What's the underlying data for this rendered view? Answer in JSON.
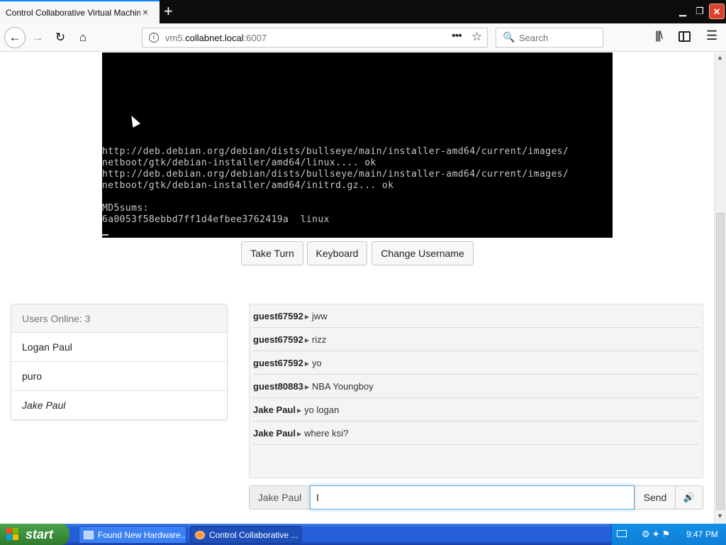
{
  "browser": {
    "tab_title": "Control Collaborative Virtual Machines!",
    "tab_close": "×",
    "new_tab": "+",
    "url_host": "vm5.",
    "url_domain": "collabnet.local",
    "url_port": ":6007",
    "search_placeholder": "Search",
    "window_min": "▁",
    "window_max": "❐",
    "window_close": "✕"
  },
  "vm": {
    "terminal_lines": [
      "http://deb.debian.org/debian/dists/bullseye/main/installer-amd64/current/images/",
      "netboot/gtk/debian-installer/amd64/linux.... ok",
      "http://deb.debian.org/debian/dists/bullseye/main/installer-amd64/current/images/",
      "netboot/gtk/debian-installer/amd64/initrd.gz... ok",
      "",
      "MD5sums:",
      "6a0053f58ebbd7ff1d4efbee3762419a  linux"
    ]
  },
  "controls": {
    "take_turn": "Take Turn",
    "keyboard": "Keyboard",
    "change_username": "Change Username"
  },
  "users": {
    "header": "Users Online: 3",
    "list": [
      "Logan Paul",
      "puro",
      "Jake Paul"
    ]
  },
  "chat": {
    "messages": [
      {
        "user": "guest67592",
        "text": "jww"
      },
      {
        "user": "guest67592",
        "text": "rizz"
      },
      {
        "user": "guest67592",
        "text": "yo"
      },
      {
        "user": "guest80883",
        "text": "NBA Youngboy"
      },
      {
        "user": "Jake Paul",
        "text": "yo logan"
      },
      {
        "user": "Jake Paul",
        "text": "where ksi?"
      }
    ],
    "username": "Jake Paul",
    "input_value": "I",
    "send_label": "Send",
    "sound_icon": "🔊"
  },
  "taskbar": {
    "start_label": "start",
    "tasks": [
      "Found New Hardware...",
      "Control Collaborative ..."
    ],
    "clock": "9:47 PM"
  },
  "colors": {
    "tab_accent": "#0a84ff",
    "taskbar_blue": "#245edb",
    "start_green": "#3c8f3c",
    "focus_blue": "#66afe9"
  }
}
